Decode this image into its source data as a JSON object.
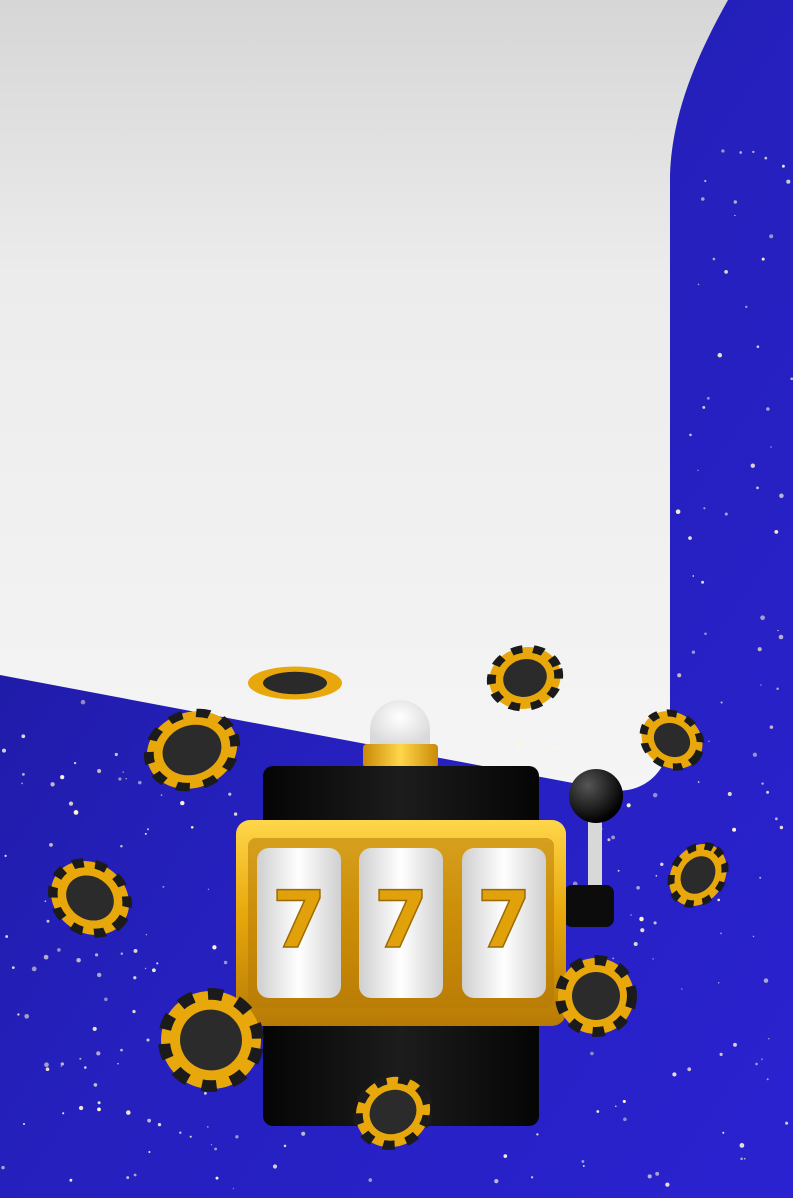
{
  "colors": {
    "background_blue": "#2720c4",
    "panel_white": "#f3f3f3",
    "gold": "#e8a80c",
    "gold_light": "#ffd64a",
    "black": "#0e0e0e",
    "star": "#fff7d6"
  },
  "slot_machine": {
    "reels": [
      "7",
      "7",
      "7"
    ]
  },
  "icons": {
    "slot_machine": "slot-machine-icon",
    "chip": "casino-chip-icon",
    "lever": "lever-icon",
    "lamp": "lamp-icon"
  }
}
